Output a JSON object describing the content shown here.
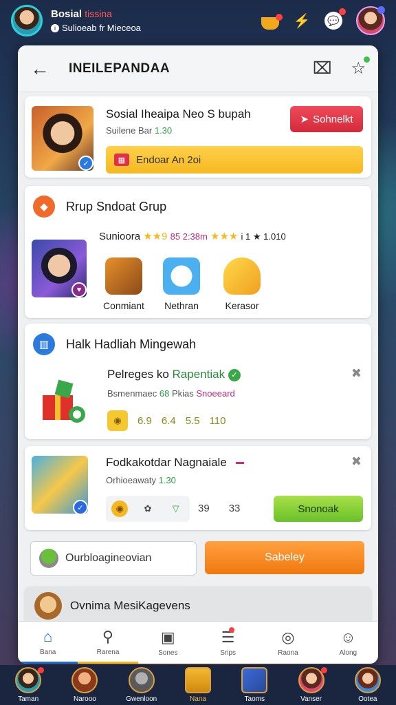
{
  "top": {
    "name": "Bosial",
    "name_tag": "tissina",
    "sub": "Sulioeab fr Mieceoa"
  },
  "header": {
    "title": "INEILEPANDAA"
  },
  "card1": {
    "title": "Sosial Iheaipa Neo S bupah",
    "sub_prefix": "Suilene Bar",
    "sub_value": "1.30",
    "button": "Sohnelkt",
    "banner": "Endoar An 2oi"
  },
  "card2": {
    "section_title": "Rrup Sndoat Grup",
    "rating_name": "Sunioora",
    "rating_stars1": "★★9",
    "rating_mid": "85 2:38m",
    "rating_stars2": "★★★",
    "rating_tail": "i 1 ★ 1.010",
    "rewards": [
      "Conmiant",
      "Nethran",
      "Kerasor"
    ]
  },
  "card3": {
    "section_title": "Halk Hadliah Mingewah",
    "title": "Pelreges ko",
    "title_tag": "Rapentiak",
    "sub_a": "Bsmenmaec",
    "sub_b": "68",
    "sub_c": "Pkias",
    "sub_d": "Snoeeard",
    "stats": [
      "6.9",
      "6.4",
      "5.5",
      "110"
    ]
  },
  "card4": {
    "title": "Fodkakotdar Nagnaiale",
    "sub_prefix": "Orhioeawaty",
    "sub_value": "1.30",
    "nums": [
      "39",
      "33"
    ],
    "button": "Snonoak"
  },
  "card5": {
    "field": "Ourbloagineovian",
    "button": "Sabeley"
  },
  "card6": {
    "title": "Ovnima MesiKagevens"
  },
  "tabs": [
    "Bana",
    "Rarena",
    "Sones",
    "Srips",
    "Raona",
    "Along"
  ],
  "bottom_nav": [
    "Taman",
    "Narooo",
    "Gwenloon",
    "Nana",
    "Taoms",
    "Vanser",
    "Ootea"
  ],
  "colors": {
    "accent": "#1a6ad8",
    "red_button": "#e03a4a",
    "green_button": "#7ac83a",
    "orange_button": "#f58a20",
    "yellow_banner": "#f5c030"
  }
}
